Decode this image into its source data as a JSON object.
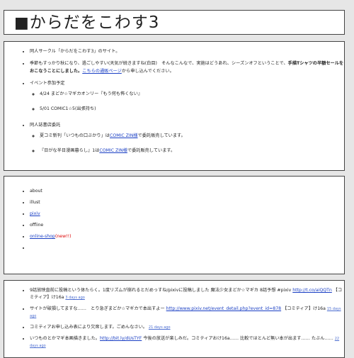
{
  "header": {
    "square": "■",
    "title": "からだをこわす3"
  },
  "info": {
    "items": [
      {
        "text": "同人サークル「からだをこわす3」のサイト。"
      },
      {
        "pre": "季節もすっかり秋になり、過ごしやすい(天気が続きますね(白目)　そんなこんなで、実施はどうあれ、シーズンオフということで、",
        "bold": "手描Tシャツの半額セールをおこなうことにしました。",
        "link": "こちらの通販ページ",
        "post": "から申し込んでください。"
      },
      {
        "text": "イベント参加予定",
        "sub": [
          "4/24 まどか☆マギカオンリー『もう何も怖くない』",
          "5/01 COMIC1☆5(出張持ち)"
        ]
      },
      {
        "text": "同人誌書店委託",
        "sub": [
          {
            "pre": "夏コミ新刊「いつもの口ぶかり」は",
            "link": "COMIC ZIN様",
            "post": "で委託販売しています。"
          },
          {
            "pre": "『日がな半日漫画暮らし』1は",
            "link": "COMIC ZIN様",
            "post": "で委託販売しています。"
          }
        ]
      }
    ]
  },
  "nav": {
    "items": [
      "about",
      "illust",
      "pixiv",
      "offline",
      "online-shop"
    ],
    "new_label": "(new!!)"
  },
  "tweets": [
    {
      "text": "9話放映直前に投稿という体たらく。1度リズムが崩れるとだめっすね/pixivに投稿しました 魔法少女まどか☆マギカ 8話予想 #pixiv ",
      "link": "http://t.co/aiQQTn",
      "post": "【コミティア】け16a ",
      "ago": "3 days ago"
    },
    {
      "text": "サイトが破損してますな……　とり急ぎまどか☆マギカで本出すよー ",
      "link": "http://www.pixiv.net/event_detail.php?event_id=878",
      "post": " 【コミティア】け16a ",
      "ago": "15 days ago"
    },
    {
      "text": "コミティアお申し込み表により欠席します。ごめんなさい。",
      "link": "",
      "post": "",
      "ago": "21 days ago"
    },
    {
      "text": "いつものとかマギ本画描きました。",
      "link": "http://bit.ly/dUsTYF",
      "post": " 今後の放送が楽しみだ。コミティアおけ16a…… 比較でほとんど無い本が出ます…… たぶん……",
      "ago": "22 days ago"
    }
  ]
}
